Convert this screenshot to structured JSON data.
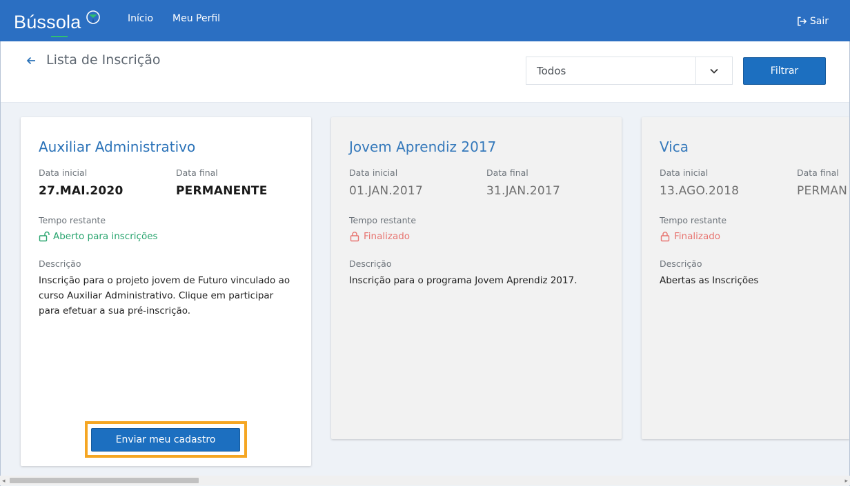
{
  "nav": {
    "brand": "Bússola",
    "links": [
      "Início",
      "Meu Perfil"
    ],
    "logout": "Sair"
  },
  "header": {
    "title": "Lista de Inscrição",
    "filter_select": "Todos",
    "filter_button": "Filtrar"
  },
  "cards": [
    {
      "title": "Auxiliar Administrativo",
      "start_label": "Data inicial",
      "start": "27.MAI.2020",
      "end_label": "Data final",
      "end": "PERMANENTE",
      "remaining_label": "Tempo restante",
      "status": "Aberto para inscrições",
      "desc_label": "Descrição",
      "description": "Inscrição para o projeto jovem de Futuro vinculado ao curso Auxiliar Administrativo. Clique em participar para efetuar a sua pré-inscrição.",
      "action": "Enviar meu cadastro"
    },
    {
      "title": "Jovem Aprendiz 2017",
      "start_label": "Data inicial",
      "start": "01.JAN.2017",
      "end_label": "Data final",
      "end": "31.JAN.2017",
      "remaining_label": "Tempo restante",
      "status": "Finalizado",
      "desc_label": "Descrição",
      "description": "Inscrição para o programa Jovem Aprendiz 2017."
    },
    {
      "title": "Vica",
      "start_label": "Data inicial",
      "start": "13.AGO.2018",
      "end_label": "Data final",
      "end": "PERMAN",
      "remaining_label": "Tempo restante",
      "status": "Finalizado",
      "desc_label": "Descrição",
      "description": "Abertas as Inscrições"
    }
  ],
  "colors": {
    "nav_bg": "#2b6fc2",
    "primary_button": "#1c6fc0",
    "open_status": "#28a46e",
    "closed_status": "#e77470",
    "highlight": "#f5a623"
  },
  "icons": [
    "compass-icon",
    "sign-out-icon",
    "arrow-left-icon",
    "chevron-down-icon",
    "unlock-icon",
    "lock-icon"
  ]
}
